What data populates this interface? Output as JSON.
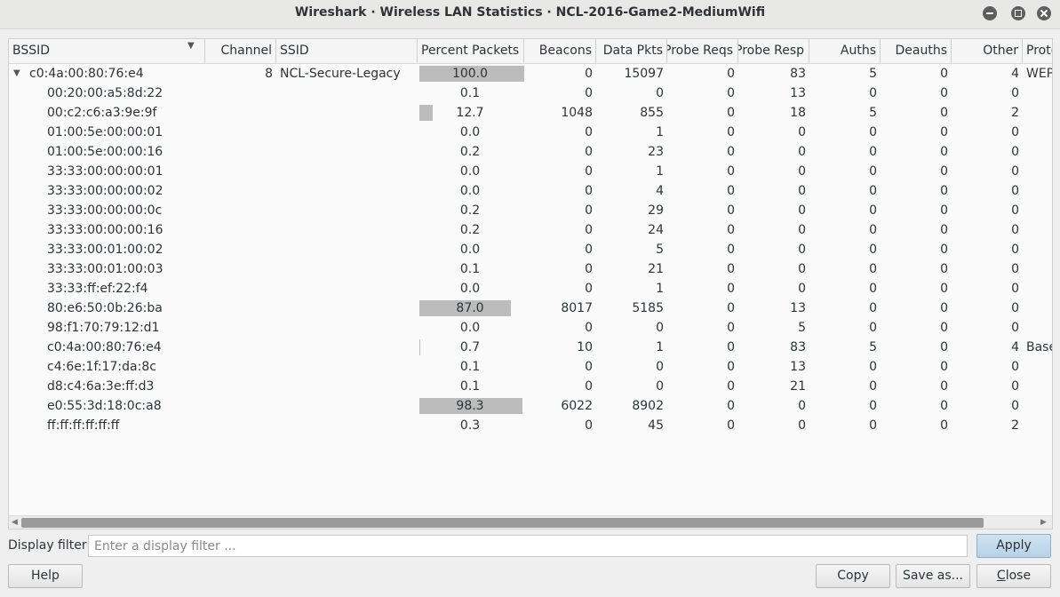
{
  "window": {
    "title": "Wireshark · Wireless LAN Statistics · NCL-2016-Game2-MediumWifi"
  },
  "columns": [
    "BSSID",
    "Channel",
    "SSID",
    "Percent Packets",
    "Beacons",
    "Data Pkts",
    "Probe Reqs",
    "Probe Resp",
    "Auths",
    "Deauths",
    "Other",
    "Protection"
  ],
  "rows": [
    {
      "bssid": "c0:4a:00:80:76:e4",
      "channel": "8",
      "ssid": "NCL-Secure-Legacy",
      "percent": "100.0",
      "percent_value": 100.0,
      "beacons": "0",
      "data": "15097",
      "probe_req": "0",
      "probe_resp": "83",
      "auths": "5",
      "deauths": "0",
      "other": "4",
      "protection": "WEP",
      "level": 0,
      "expanded": true
    },
    {
      "bssid": "00:20:00:a5:8d:22",
      "channel": "",
      "ssid": "",
      "percent": "0.1",
      "percent_value": 0.1,
      "beacons": "0",
      "data": "0",
      "probe_req": "0",
      "probe_resp": "13",
      "auths": "0",
      "deauths": "0",
      "other": "0",
      "protection": "",
      "level": 1
    },
    {
      "bssid": "00:c2:c6:a3:9e:9f",
      "channel": "",
      "ssid": "",
      "percent": "12.7",
      "percent_value": 12.7,
      "beacons": "1048",
      "data": "855",
      "probe_req": "0",
      "probe_resp": "18",
      "auths": "5",
      "deauths": "0",
      "other": "2",
      "protection": "",
      "level": 1
    },
    {
      "bssid": "01:00:5e:00:00:01",
      "channel": "",
      "ssid": "",
      "percent": "0.0",
      "percent_value": 0.0,
      "beacons": "0",
      "data": "1",
      "probe_req": "0",
      "probe_resp": "0",
      "auths": "0",
      "deauths": "0",
      "other": "0",
      "protection": "",
      "level": 1
    },
    {
      "bssid": "01:00:5e:00:00:16",
      "channel": "",
      "ssid": "",
      "percent": "0.2",
      "percent_value": 0.2,
      "beacons": "0",
      "data": "23",
      "probe_req": "0",
      "probe_resp": "0",
      "auths": "0",
      "deauths": "0",
      "other": "0",
      "protection": "",
      "level": 1
    },
    {
      "bssid": "33:33:00:00:00:01",
      "channel": "",
      "ssid": "",
      "percent": "0.0",
      "percent_value": 0.0,
      "beacons": "0",
      "data": "1",
      "probe_req": "0",
      "probe_resp": "0",
      "auths": "0",
      "deauths": "0",
      "other": "0",
      "protection": "",
      "level": 1
    },
    {
      "bssid": "33:33:00:00:00:02",
      "channel": "",
      "ssid": "",
      "percent": "0.0",
      "percent_value": 0.0,
      "beacons": "0",
      "data": "4",
      "probe_req": "0",
      "probe_resp": "0",
      "auths": "0",
      "deauths": "0",
      "other": "0",
      "protection": "",
      "level": 1
    },
    {
      "bssid": "33:33:00:00:00:0c",
      "channel": "",
      "ssid": "",
      "percent": "0.2",
      "percent_value": 0.2,
      "beacons": "0",
      "data": "29",
      "probe_req": "0",
      "probe_resp": "0",
      "auths": "0",
      "deauths": "0",
      "other": "0",
      "protection": "",
      "level": 1
    },
    {
      "bssid": "33:33:00:00:00:16",
      "channel": "",
      "ssid": "",
      "percent": "0.2",
      "percent_value": 0.2,
      "beacons": "0",
      "data": "24",
      "probe_req": "0",
      "probe_resp": "0",
      "auths": "0",
      "deauths": "0",
      "other": "0",
      "protection": "",
      "level": 1
    },
    {
      "bssid": "33:33:00:01:00:02",
      "channel": "",
      "ssid": "",
      "percent": "0.0",
      "percent_value": 0.0,
      "beacons": "0",
      "data": "5",
      "probe_req": "0",
      "probe_resp": "0",
      "auths": "0",
      "deauths": "0",
      "other": "0",
      "protection": "",
      "level": 1
    },
    {
      "bssid": "33:33:00:01:00:03",
      "channel": "",
      "ssid": "",
      "percent": "0.1",
      "percent_value": 0.1,
      "beacons": "0",
      "data": "21",
      "probe_req": "0",
      "probe_resp": "0",
      "auths": "0",
      "deauths": "0",
      "other": "0",
      "protection": "",
      "level": 1
    },
    {
      "bssid": "33:33:ff:ef:22:f4",
      "channel": "",
      "ssid": "",
      "percent": "0.0",
      "percent_value": 0.0,
      "beacons": "0",
      "data": "1",
      "probe_req": "0",
      "probe_resp": "0",
      "auths": "0",
      "deauths": "0",
      "other": "0",
      "protection": "",
      "level": 1
    },
    {
      "bssid": "80:e6:50:0b:26:ba",
      "channel": "",
      "ssid": "",
      "percent": "87.0",
      "percent_value": 87.0,
      "beacons": "8017",
      "data": "5185",
      "probe_req": "0",
      "probe_resp": "13",
      "auths": "0",
      "deauths": "0",
      "other": "0",
      "protection": "",
      "level": 1
    },
    {
      "bssid": "98:f1:70:79:12:d1",
      "channel": "",
      "ssid": "",
      "percent": "0.0",
      "percent_value": 0.0,
      "beacons": "0",
      "data": "0",
      "probe_req": "0",
      "probe_resp": "5",
      "auths": "0",
      "deauths": "0",
      "other": "0",
      "protection": "",
      "level": 1
    },
    {
      "bssid": "c0:4a:00:80:76:e4",
      "channel": "",
      "ssid": "",
      "percent": "0.7",
      "percent_value": 0.7,
      "beacons": "10",
      "data": "1",
      "probe_req": "0",
      "probe_resp": "83",
      "auths": "5",
      "deauths": "0",
      "other": "4",
      "protection": "Base",
      "level": 1
    },
    {
      "bssid": "c4:6e:1f:17:da:8c",
      "channel": "",
      "ssid": "",
      "percent": "0.1",
      "percent_value": 0.1,
      "beacons": "0",
      "data": "0",
      "probe_req": "0",
      "probe_resp": "13",
      "auths": "0",
      "deauths": "0",
      "other": "0",
      "protection": "",
      "level": 1
    },
    {
      "bssid": "d8:c4:6a:3e:ff:d3",
      "channel": "",
      "ssid": "",
      "percent": "0.1",
      "percent_value": 0.1,
      "beacons": "0",
      "data": "0",
      "probe_req": "0",
      "probe_resp": "21",
      "auths": "0",
      "deauths": "0",
      "other": "0",
      "protection": "",
      "level": 1
    },
    {
      "bssid": "e0:55:3d:18:0c:a8",
      "channel": "",
      "ssid": "",
      "percent": "98.3",
      "percent_value": 98.3,
      "beacons": "6022",
      "data": "8902",
      "probe_req": "0",
      "probe_resp": "0",
      "auths": "0",
      "deauths": "0",
      "other": "0",
      "protection": "",
      "level": 1
    },
    {
      "bssid": "ff:ff:ff:ff:ff:ff",
      "channel": "",
      "ssid": "",
      "percent": "0.3",
      "percent_value": 0.3,
      "beacons": "0",
      "data": "45",
      "probe_req": "0",
      "probe_resp": "0",
      "auths": "0",
      "deauths": "0",
      "other": "2",
      "protection": "",
      "level": 1
    }
  ],
  "filter": {
    "label": "Display filter:",
    "placeholder": "Enter a display filter ...",
    "value": "",
    "apply_label": "Apply"
  },
  "buttons": {
    "help": "Help",
    "copy": "Copy",
    "save_as": "Save as...",
    "close": "Close"
  },
  "colors": {
    "bar": "#bcbcbc",
    "apply_bg": "#c3d9ec"
  }
}
